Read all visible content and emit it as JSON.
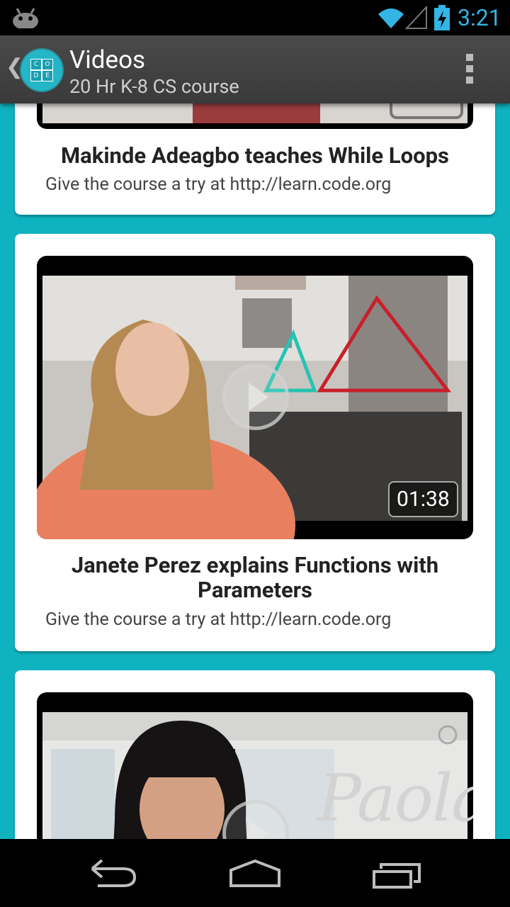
{
  "status_bar": {
    "time": "3:21"
  },
  "action_bar": {
    "logo_letters": [
      "C",
      "O",
      "D",
      "E"
    ],
    "title": "Videos",
    "subtitle": "20 Hr K-8 CS course"
  },
  "videos": [
    {
      "title": "Makinde Adeagbo teaches While Loops",
      "subtitle": "Give the course a try at http://learn.code.org"
    },
    {
      "title": "Janete Perez explains Functions with Parameters",
      "subtitle": "Give the course a try at http://learn.code.org",
      "duration": "01:38"
    },
    {
      "title": "",
      "subtitle": "",
      "overlay_text": "Paola"
    }
  ]
}
